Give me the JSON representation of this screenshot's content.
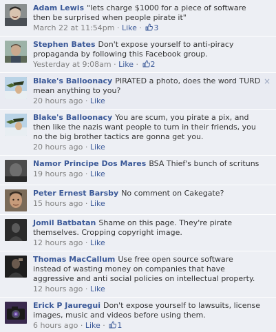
{
  "comments": [
    {
      "author": "Adam Lewis",
      "text": "\"lets charge $1000 for a piece of software then be surprised when people pirate it\"",
      "time": "March 22 at 11:54pm",
      "like_label": "Like",
      "like_count": "3",
      "avatar_icon": "profile-photo-man-smiling"
    },
    {
      "author": "Stephen Bates",
      "text": "Don't expose yourself to anti-piracy propaganda by following this Facebook group.",
      "time": "Yesterday at 9:08am",
      "like_label": "Like",
      "like_count": "2",
      "avatar_icon": "profile-photo-man-outdoors"
    },
    {
      "author": "Blake's Balloonacy",
      "text": "PIRATED a photo, does the word TURD mean anything to you?",
      "time": "20 hours ago",
      "like_label": "Like",
      "close_icon": "×",
      "avatar_icon": "profile-photo-balloon"
    },
    {
      "author": "Blake's Balloonacy",
      "text": "You are scum, you pirate a pix, and then like the nazis want people to turn in their friends, you no the big brother tactics are gonna get you.",
      "time": "20 hours ago",
      "like_label": "Like",
      "avatar_icon": "profile-photo-balloon"
    },
    {
      "author": "Namor Principe Dos Mares",
      "text": "BSA Thief's bunch of scrituns",
      "time": "19 hours ago",
      "like_label": "Like",
      "avatar_icon": "profile-photo-dark"
    },
    {
      "author": "Peter Ernest Barsby",
      "text": "No comment on Cakegate?",
      "time": "15 hours ago",
      "like_label": "Like",
      "avatar_icon": "profile-photo-man-face"
    },
    {
      "author": "Jomil Batbatan",
      "text": "Shame on this page. They're pirate themselves. Cropping copyright image.",
      "time": "12 hours ago",
      "like_label": "Like",
      "avatar_icon": "profile-photo-dark-figure"
    },
    {
      "author": "Thomas MacCallum",
      "text": "Use free open source software instead of wasting money on companies that have aggressive and anti social policies on intellectual property.",
      "time": "12 hours ago",
      "like_label": "Like",
      "avatar_icon": "profile-photo-dark-figure"
    },
    {
      "author": "Erick P Jauregui",
      "text": "Don't expose yourself to lawsuits, license images, music and videos before using them.",
      "time": "6 hours ago",
      "like_label": "Like",
      "like_count": "1",
      "avatar_icon": "profile-photo-camera"
    }
  ],
  "separator": " · ",
  "colors": {
    "background": "#edeff4",
    "link": "#3b5998",
    "meta": "#808080",
    "text": "#333333"
  }
}
